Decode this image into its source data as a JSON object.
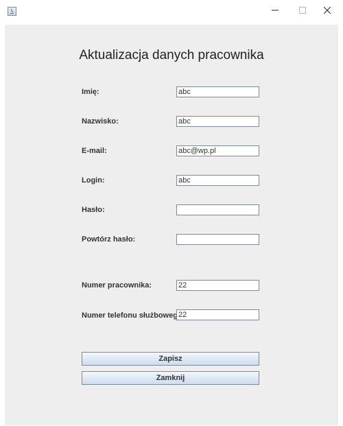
{
  "window": {
    "controls": {
      "minimize": "–",
      "maximize": "□",
      "close": "✕"
    }
  },
  "form": {
    "heading": "Aktualizacja danych pracownika",
    "fields": [
      {
        "label": "Imię:",
        "value": ""
      },
      {
        "label": "Nazwisko:",
        "value": "abc"
      },
      {
        "label": "E-mail:",
        "value": "abc@wp.pl"
      },
      {
        "label": "Login:",
        "value": "abc"
      },
      {
        "label": "Hasło:",
        "value": ""
      },
      {
        "label": "Powtórz hasło:",
        "value": ""
      },
      {
        "label": "Numer pracownika:",
        "value": "22"
      },
      {
        "label": "Numer telefonu służbowego:",
        "value": "22"
      }
    ],
    "first_field_value": "abc",
    "save_label": "Zapisz",
    "close_label": "Zamknij"
  },
  "colors": {
    "panel_background": "#eeeeee",
    "field_border": "#7a8a99",
    "button_gradient_top": "#f3f7fc",
    "button_gradient_bottom": "#cfdced"
  },
  "icons": {
    "app": "java-app-icon"
  }
}
